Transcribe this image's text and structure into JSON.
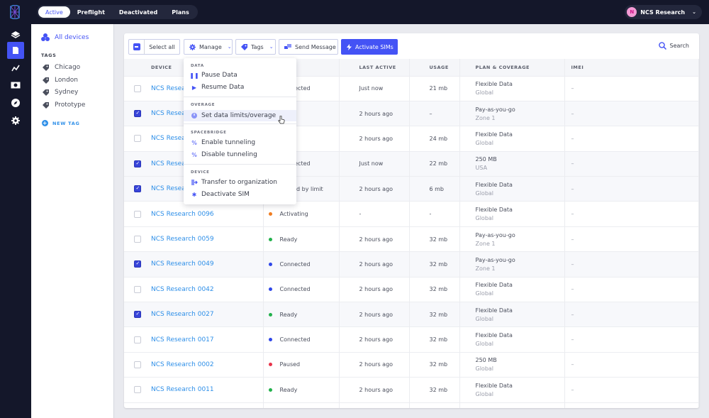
{
  "nav": {
    "tabs": [
      {
        "label": "Active",
        "active": true
      },
      {
        "label": "Preflight",
        "active": false
      },
      {
        "label": "Deactivated",
        "active": false
      },
      {
        "label": "Plans",
        "active": false
      }
    ],
    "org": {
      "initial": "N",
      "name": "NCS Research"
    },
    "rail_icons": [
      "stack-icon",
      "sim-card-icon",
      "chart-icon",
      "billing-icon",
      "compass-icon",
      "gear-icon"
    ]
  },
  "sidebar": {
    "all_devices": "All devices",
    "tags_title": "TAGS",
    "tags": [
      "Chicago",
      "London",
      "Sydney",
      "Prototype"
    ],
    "new_tag": "NEW TAG"
  },
  "toolbar": {
    "select_all": "Select all",
    "manage": "Manage",
    "tags": "Tags",
    "send_message": "Send Message",
    "activate_sims": "Activate SIMs",
    "search": "Search"
  },
  "table": {
    "columns": [
      "DEVICE",
      "",
      "LAST ACTIVE",
      "USAGE",
      "PLAN & COVERAGE",
      "IMEI"
    ],
    "rows": [
      {
        "checked": false,
        "device": "NCS Research",
        "status": "Connected",
        "status_color": "#2f47e8",
        "last_active": "Just now",
        "usage": "21 mb",
        "plan": "Flexible Data",
        "coverage": "Global",
        "imei": "–"
      },
      {
        "checked": true,
        "device": "NCS Research",
        "status": "",
        "status_color": "",
        "last_active": "2 hours ago",
        "usage": "–",
        "plan": "Pay-as-you-go",
        "coverage": "Zone 1",
        "imei": "–"
      },
      {
        "checked": false,
        "device": "NCS Research",
        "status": "",
        "status_color": "",
        "last_active": "2 hours ago",
        "usage": "24 mb",
        "plan": "Flexible Data",
        "coverage": "Global",
        "imei": "–"
      },
      {
        "checked": true,
        "device": "NCS Research",
        "status": "Connected",
        "status_color": "#2f47e8",
        "last_active": "Just now",
        "usage": "22 mb",
        "plan": "250 MB",
        "coverage": "USA",
        "imei": "–"
      },
      {
        "checked": true,
        "device": "NCS Research",
        "status": "Paused by limit",
        "status_color": "#e8334a",
        "last_active": "2 hours ago",
        "usage": "6 mb",
        "plan": "Flexible Data",
        "coverage": "Global",
        "imei": "–"
      },
      {
        "checked": false,
        "device": "NCS Research 0096",
        "status": "Activating",
        "status_color": "#ef7d22",
        "last_active": "-",
        "usage": "-",
        "plan": "Flexible Data",
        "coverage": "Global",
        "imei": "–"
      },
      {
        "checked": false,
        "device": "NCS Research 0059",
        "status": "Ready",
        "status_color": "#22b14c",
        "last_active": "2 hours ago",
        "usage": "32 mb",
        "plan": "Pay-as-you-go",
        "coverage": "Zone 1",
        "imei": "–"
      },
      {
        "checked": true,
        "device": "NCS Research 0049",
        "status": "Connected",
        "status_color": "#2f47e8",
        "last_active": "2 hours ago",
        "usage": "32 mb",
        "plan": "Pay-as-you-go",
        "coverage": "Zone 1",
        "imei": "–"
      },
      {
        "checked": false,
        "device": "NCS Research 0042",
        "status": "Connected",
        "status_color": "#2f47e8",
        "last_active": "2 hours ago",
        "usage": "32 mb",
        "plan": "Flexible Data",
        "coverage": "Global",
        "imei": "–"
      },
      {
        "checked": true,
        "device": "NCS Research 0027",
        "status": "Ready",
        "status_color": "#22b14c",
        "last_active": "2 hours ago",
        "usage": "32 mb",
        "plan": "Flexible Data",
        "coverage": "Global",
        "imei": "–"
      },
      {
        "checked": false,
        "device": "NCS Research 0017",
        "status": "Connected",
        "status_color": "#2f47e8",
        "last_active": "2 hours ago",
        "usage": "32 mb",
        "plan": "Flexible Data",
        "coverage": "Global",
        "imei": "–"
      },
      {
        "checked": false,
        "device": "NCS Research 0002",
        "status": "Paused",
        "status_color": "#e8334a",
        "last_active": "2 hours ago",
        "usage": "32 mb",
        "plan": "250 MB",
        "coverage": "Global",
        "imei": "–"
      },
      {
        "checked": false,
        "device": "NCS Research 0011",
        "status": "Ready",
        "status_color": "#22b14c",
        "last_active": "2 hours ago",
        "usage": "32 mb",
        "plan": "Flexible Data",
        "coverage": "Global",
        "imei": "–"
      }
    ]
  },
  "manage_menu": {
    "sections": [
      {
        "title": "DATA",
        "items": [
          {
            "label": "Pause Data",
            "icon": "pause-icon"
          },
          {
            "label": "Resume Data",
            "icon": "play-icon"
          }
        ]
      },
      {
        "title": "OVERAGE",
        "items": [
          {
            "label": "Set data limits/overage",
            "icon": "gauge-icon",
            "hover": true
          }
        ]
      },
      {
        "title": "SPACEBRIDGE",
        "items": [
          {
            "label": "Enable tunneling",
            "icon": "tunnel-icon"
          },
          {
            "label": "Disable tunneling",
            "icon": "tunnel-off-icon"
          }
        ]
      },
      {
        "title": "DEVICE",
        "items": [
          {
            "label": "Transfer to organization",
            "icon": "transfer-icon"
          },
          {
            "label": "Deactivate SIM",
            "icon": "deactivate-icon"
          }
        ]
      }
    ]
  },
  "colors": {
    "accent": "#4453f5",
    "link": "#2e8fe8",
    "nav_bg": "#14172a"
  }
}
